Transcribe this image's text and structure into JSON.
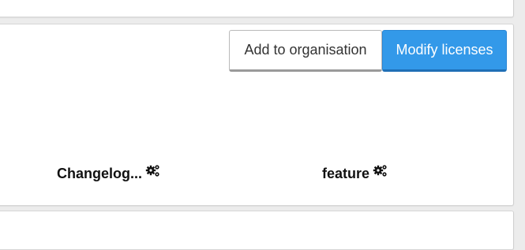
{
  "toolbar": {
    "add_label": "Add to organisation",
    "modify_label": "Modify licenses",
    "primary_color": "#3399e9"
  },
  "items": [
    {
      "title": "Changelog...",
      "icon": "gears-icon"
    },
    {
      "title": "feature",
      "icon": "gears-icon"
    }
  ]
}
